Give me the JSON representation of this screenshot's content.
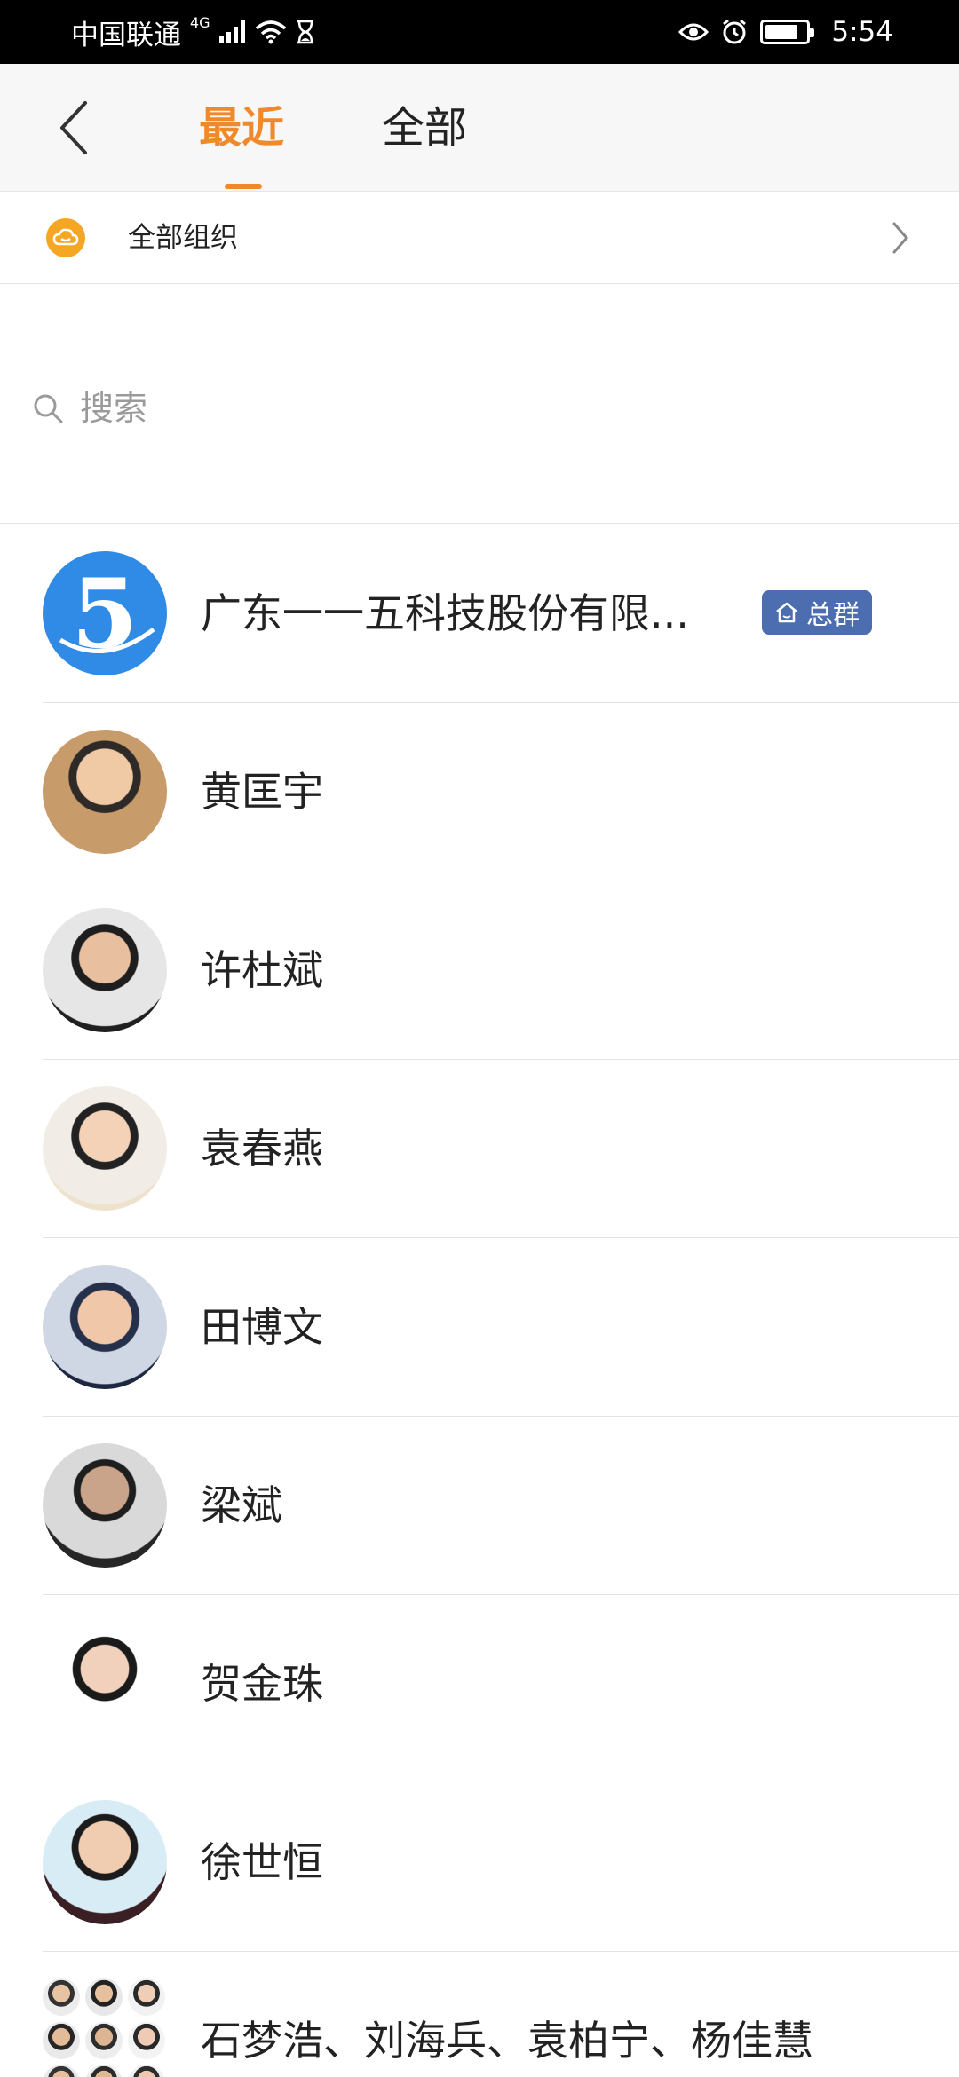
{
  "status_bar": {
    "carrier": "中国联通",
    "network": "4G",
    "time": "5:54"
  },
  "nav": {
    "tab_recent": "最近",
    "tab_all": "全部"
  },
  "org_row": {
    "label": "全部组织"
  },
  "search": {
    "placeholder": "搜索"
  },
  "contacts": [
    {
      "name": "广东一一五科技股份有限...",
      "badge": "总群"
    },
    {
      "name": "黄匡宇"
    },
    {
      "name": "许杜斌"
    },
    {
      "name": "袁春燕"
    },
    {
      "name": "田博文"
    },
    {
      "name": "梁斌"
    },
    {
      "name": "贺金珠"
    },
    {
      "name": "徐世恒"
    },
    {
      "name": "石梦浩、刘海兵、袁柏宁、杨佳慧"
    }
  ],
  "colors": {
    "accent": "#f0892a",
    "badge": "#4d6db1",
    "org_icon": "#f5a623",
    "company_logo": "#2f8be6"
  }
}
